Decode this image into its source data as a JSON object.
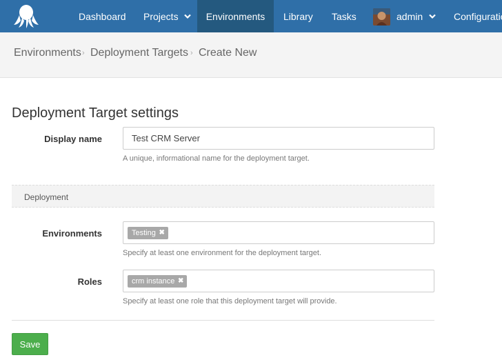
{
  "nav": {
    "logo_icon": "octopus-logo-icon",
    "items": [
      {
        "label": "Dashboard"
      },
      {
        "label": "Projects",
        "has_dropdown": true
      },
      {
        "label": "Environments",
        "active": true
      },
      {
        "label": "Library"
      },
      {
        "label": "Tasks"
      },
      {
        "label": "admin",
        "has_dropdown": true
      },
      {
        "label": "Configuratio"
      }
    ],
    "colors": {
      "bar": "#2f6fa8",
      "active": "#24597f"
    }
  },
  "breadcrumb": [
    "Environments",
    "Deployment Targets",
    "Create New"
  ],
  "form": {
    "title": "Deployment Target settings",
    "display_name": {
      "label": "Display name",
      "value": "Test CRM Server",
      "help": "A unique, informational name for the deployment target."
    },
    "group_title": "Deployment",
    "environments": {
      "label": "Environments",
      "tags": [
        "Testing"
      ],
      "help": "Specify at least one environment for the deployment target."
    },
    "roles": {
      "label": "Roles",
      "tags": [
        "crm instance"
      ],
      "help": "Specify at least one role that this deployment target will provide."
    },
    "save_label": "Save",
    "save_color": "#4cae4c"
  }
}
